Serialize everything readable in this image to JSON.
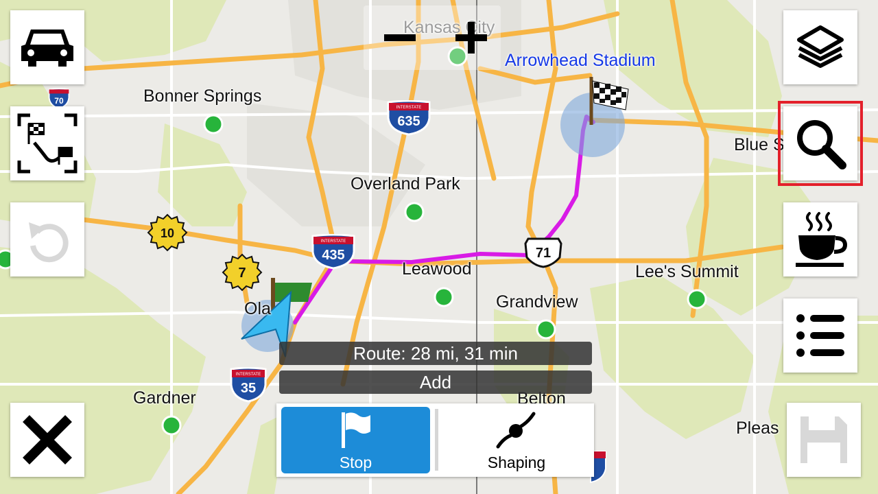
{
  "map": {
    "places": [
      {
        "name": "Kansas City"
      },
      {
        "name": "Arrowhead Stadium"
      },
      {
        "name": "Bonner Springs"
      },
      {
        "name": "Overland Park"
      },
      {
        "name": "Blue S"
      },
      {
        "name": "Leawood"
      },
      {
        "name": "Grandview"
      },
      {
        "name": "Lee's Summit"
      },
      {
        "name": "Ola"
      },
      {
        "name": "Gardner"
      },
      {
        "name": "Belton"
      },
      {
        "name": "Pleas"
      }
    ],
    "shields": {
      "i70": "70",
      "i635": "635",
      "i435": "435",
      "i35": "35",
      "us71": "71",
      "k10": "10",
      "k7": "7",
      "interstate_label": "INTERSTATE"
    },
    "colors": {
      "route": "#d81be6",
      "highway": "#f7b545",
      "interstate_blue": "#1f4ea3",
      "interstate_red": "#c8102e",
      "state_yellow": "#f2d02a",
      "city_dot": "#27b43b",
      "active_button": "#1d8cd8",
      "highlight": "#e3202b"
    }
  },
  "zoom": {
    "minus": "−",
    "plus": "+"
  },
  "left_buttons": [
    {
      "icon": "car-icon"
    },
    {
      "icon": "route-fit-icon"
    },
    {
      "icon": "undo-icon"
    },
    {
      "icon": "close-icon"
    }
  ],
  "right_buttons": [
    {
      "icon": "layers-icon"
    },
    {
      "icon": "search-icon"
    },
    {
      "icon": "coffee-cup-icon"
    },
    {
      "icon": "list-icon"
    },
    {
      "icon": "save-icon"
    }
  ],
  "route_info": {
    "summary": "Route: 28 mi, 31 min",
    "add_label": "Add"
  },
  "modes": {
    "stop_label": "Stop",
    "shaping_label": "Shaping"
  }
}
